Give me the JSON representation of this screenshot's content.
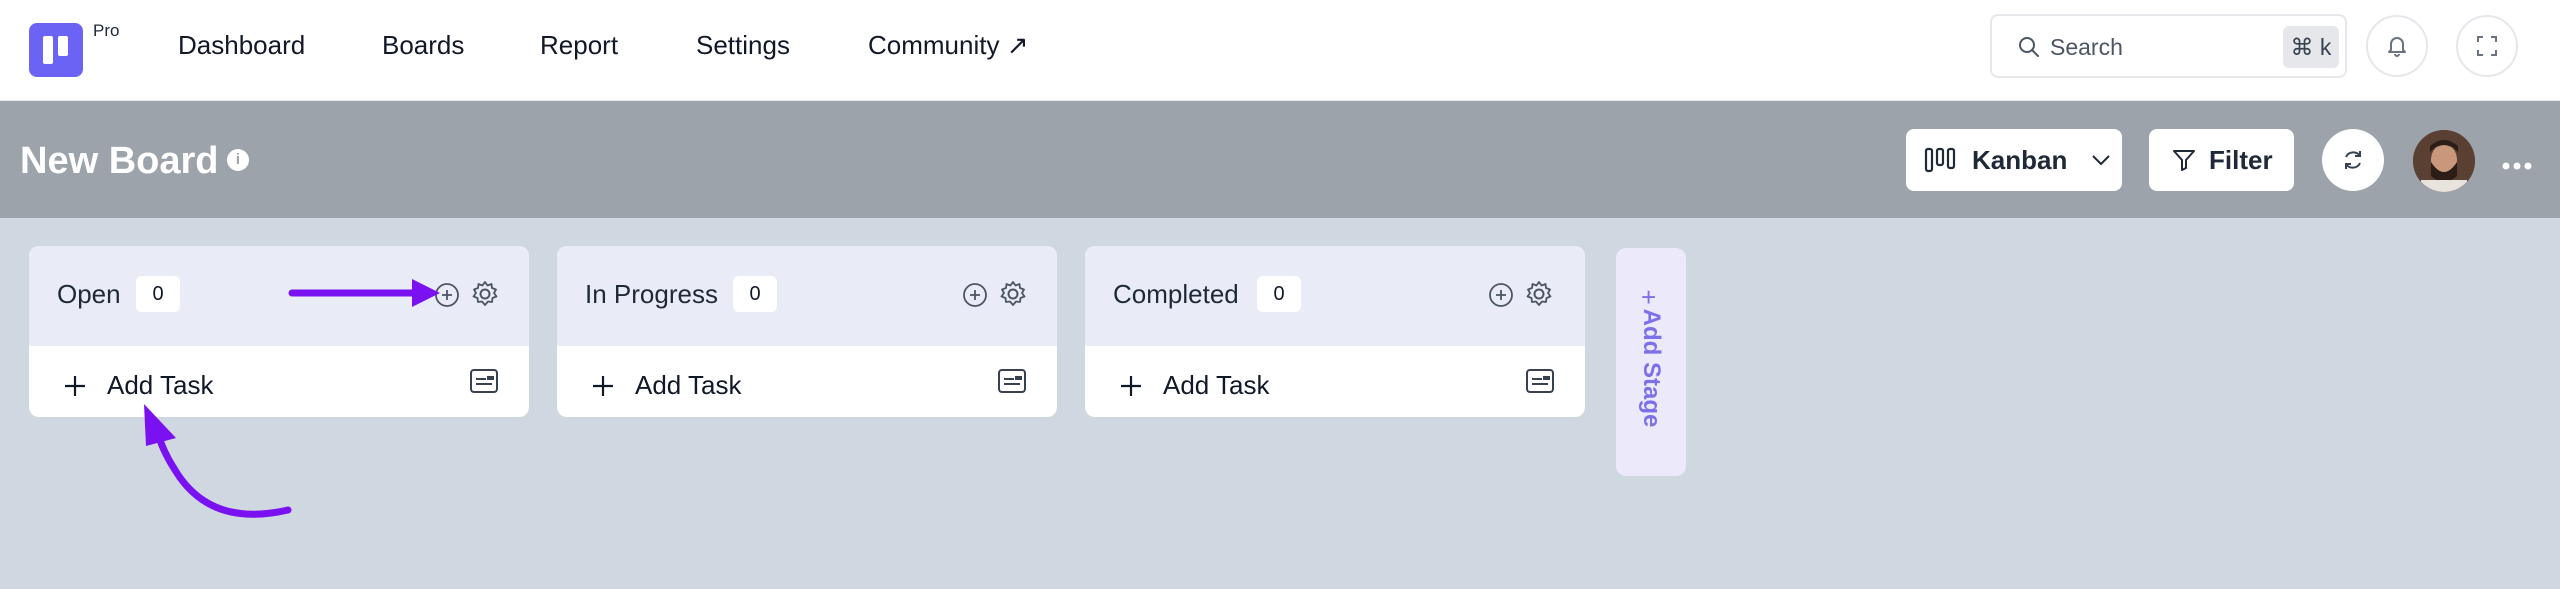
{
  "app": {
    "badge": "Pro"
  },
  "nav": {
    "items": [
      "Dashboard",
      "Boards",
      "Report",
      "Settings",
      "Community ↗"
    ]
  },
  "search": {
    "placeholder": "Search",
    "shortcut": "⌘ k"
  },
  "board": {
    "title": "New Board",
    "view_label": "Kanban",
    "filter_label": "Filter"
  },
  "columns": [
    {
      "name": "Open",
      "count": "0",
      "add_task_label": "Add Task"
    },
    {
      "name": "In Progress",
      "count": "0",
      "add_task_label": "Add Task"
    },
    {
      "name": "Completed",
      "count": "0",
      "add_task_label": "Add Task"
    }
  ],
  "add_stage_label": "Add Stage",
  "colors": {
    "accent": "#6a63f4",
    "annotation_arrow": "#7a11f0",
    "header_bg": "#9ca3ab",
    "canvas_bg": "#cfd8e0"
  }
}
